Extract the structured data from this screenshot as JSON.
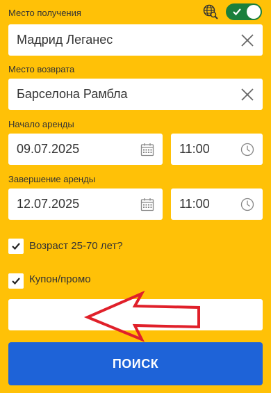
{
  "pickup": {
    "label": "Место получения",
    "value": "Мадрид Леганес"
  },
  "dropoff": {
    "label": "Место возврата",
    "value": "Барселона Рамбла"
  },
  "start": {
    "label": "Начало аренды",
    "date": "09.07.2025",
    "time": "11:00"
  },
  "end": {
    "label": "Завершение аренды",
    "date": "12.07.2025",
    "time": "11:00"
  },
  "age": {
    "label": "Возраст 25-70 лет?",
    "checked": true
  },
  "coupon": {
    "label": "Купон/промо",
    "checked": true,
    "value": ""
  },
  "search_button": {
    "label": "ПОИСК"
  },
  "toggle": {
    "on": true
  },
  "colors": {
    "background": "#FFC107",
    "accent": "#1E63D8",
    "toggle": "#1A7F3C",
    "arrow": "#E0202A"
  }
}
